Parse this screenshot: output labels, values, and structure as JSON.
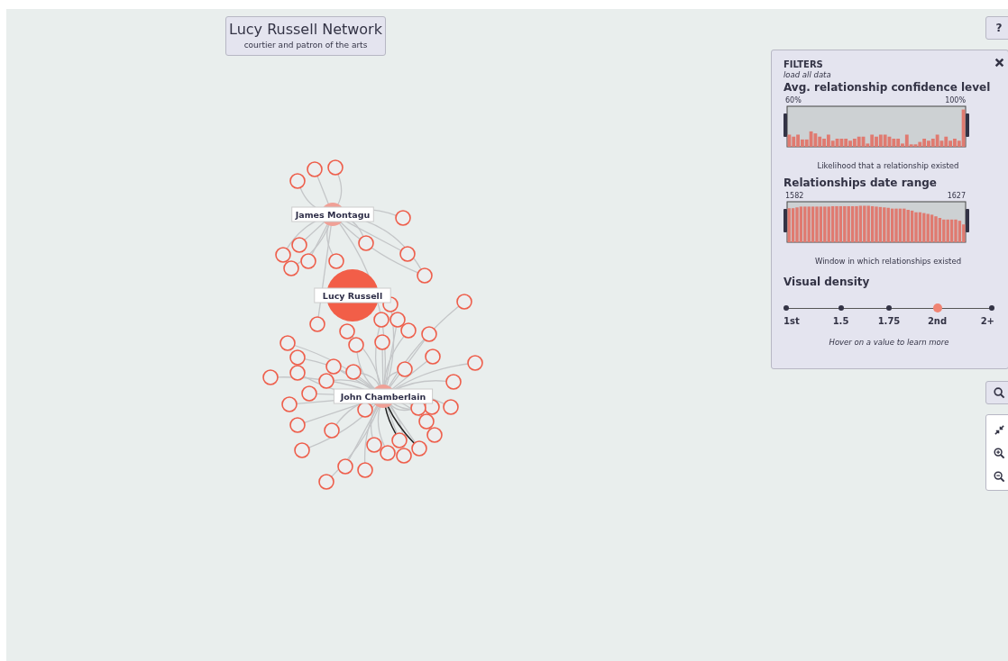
{
  "header": {
    "title": "Lucy Russell Network",
    "subtitle": "courtier and patron of the arts"
  },
  "graph": {
    "nodes": [
      {
        "label": "James Montagu",
        "kind": "hub"
      },
      {
        "label": "Lucy Russell",
        "kind": "focus"
      },
      {
        "label": "John Chamberlain",
        "kind": "hub"
      }
    ]
  },
  "help_button": {
    "label": "?"
  },
  "filters": {
    "title": "FILTERS",
    "load_link": "load all data",
    "confidence": {
      "heading": "Avg. relationship confidence level",
      "min_label": "60%",
      "max_label": "100%",
      "caption": "Likelihood that a relationship existed",
      "handles": [
        {
          "level": 0
        },
        {
          "level": 1
        }
      ]
    },
    "date_range": {
      "heading": "Relationships date range",
      "min_label": "1582",
      "max_label": "1627",
      "caption": "Window in which relationships existed",
      "handles": [
        {
          "level": 0
        },
        {
          "level": 1
        }
      ]
    },
    "density": {
      "heading": "Visual density",
      "hint": "Hover on a value to learn more",
      "stops": [
        {
          "label": "1st",
          "selected": false
        },
        {
          "label": "1.5",
          "selected": false
        },
        {
          "label": "1.75",
          "selected": false
        },
        {
          "label": "2nd",
          "selected": true
        },
        {
          "label": "2+",
          "selected": false
        }
      ]
    }
  }
}
